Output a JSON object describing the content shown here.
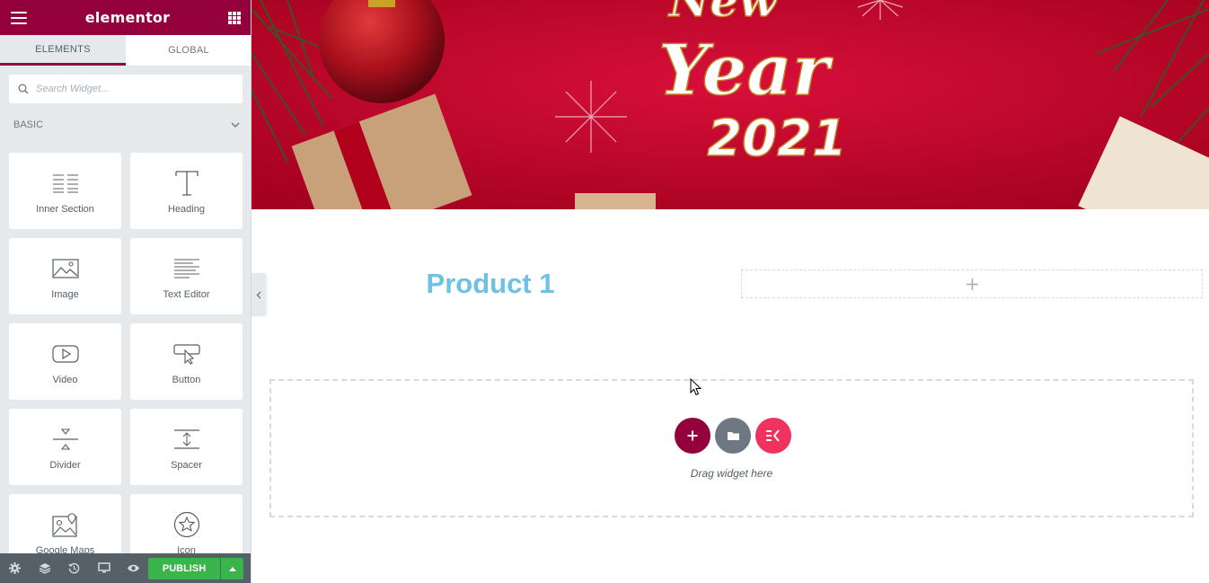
{
  "app": {
    "logo": "elementor",
    "brand_color": "#93003c"
  },
  "panel": {
    "tabs": [
      {
        "label": "ELEMENTS",
        "active": true
      },
      {
        "label": "GLOBAL",
        "active": false
      }
    ],
    "search": {
      "placeholder": "Search Widget..."
    },
    "category": {
      "label": "BASIC",
      "icon": "chevron-down-icon"
    },
    "widgets": [
      {
        "label": "Inner Section",
        "icon": "inner-section-icon"
      },
      {
        "label": "Heading",
        "icon": "heading-icon"
      },
      {
        "label": "Image",
        "icon": "image-icon"
      },
      {
        "label": "Text Editor",
        "icon": "text-editor-icon"
      },
      {
        "label": "Video",
        "icon": "video-icon"
      },
      {
        "label": "Button",
        "icon": "button-icon"
      },
      {
        "label": "Divider",
        "icon": "divider-icon"
      },
      {
        "label": "Spacer",
        "icon": "spacer-icon"
      },
      {
        "label": "Google Maps",
        "icon": "google-maps-icon"
      },
      {
        "label": "Icon",
        "icon": "star-icon"
      }
    ],
    "footer": {
      "icons": [
        "settings-icon",
        "layers-icon",
        "history-icon",
        "responsive-icon",
        "preview-icon"
      ],
      "publish_label": "PUBLISH",
      "publish_color": "#39b54a"
    }
  },
  "canvas": {
    "banner": {
      "text_line1": "New",
      "text_line2": "Year",
      "text_line3": "2021"
    },
    "product_title": "Product 1",
    "product_title_color": "#6ec1e4",
    "dropzone": {
      "text": "Drag widget here",
      "buttons": [
        {
          "icon": "plus-icon",
          "color": "#93003c"
        },
        {
          "icon": "folder-icon",
          "color": "#6d7882"
        },
        {
          "icon": "elementskit-icon",
          "color": "#f0325e"
        }
      ]
    }
  }
}
